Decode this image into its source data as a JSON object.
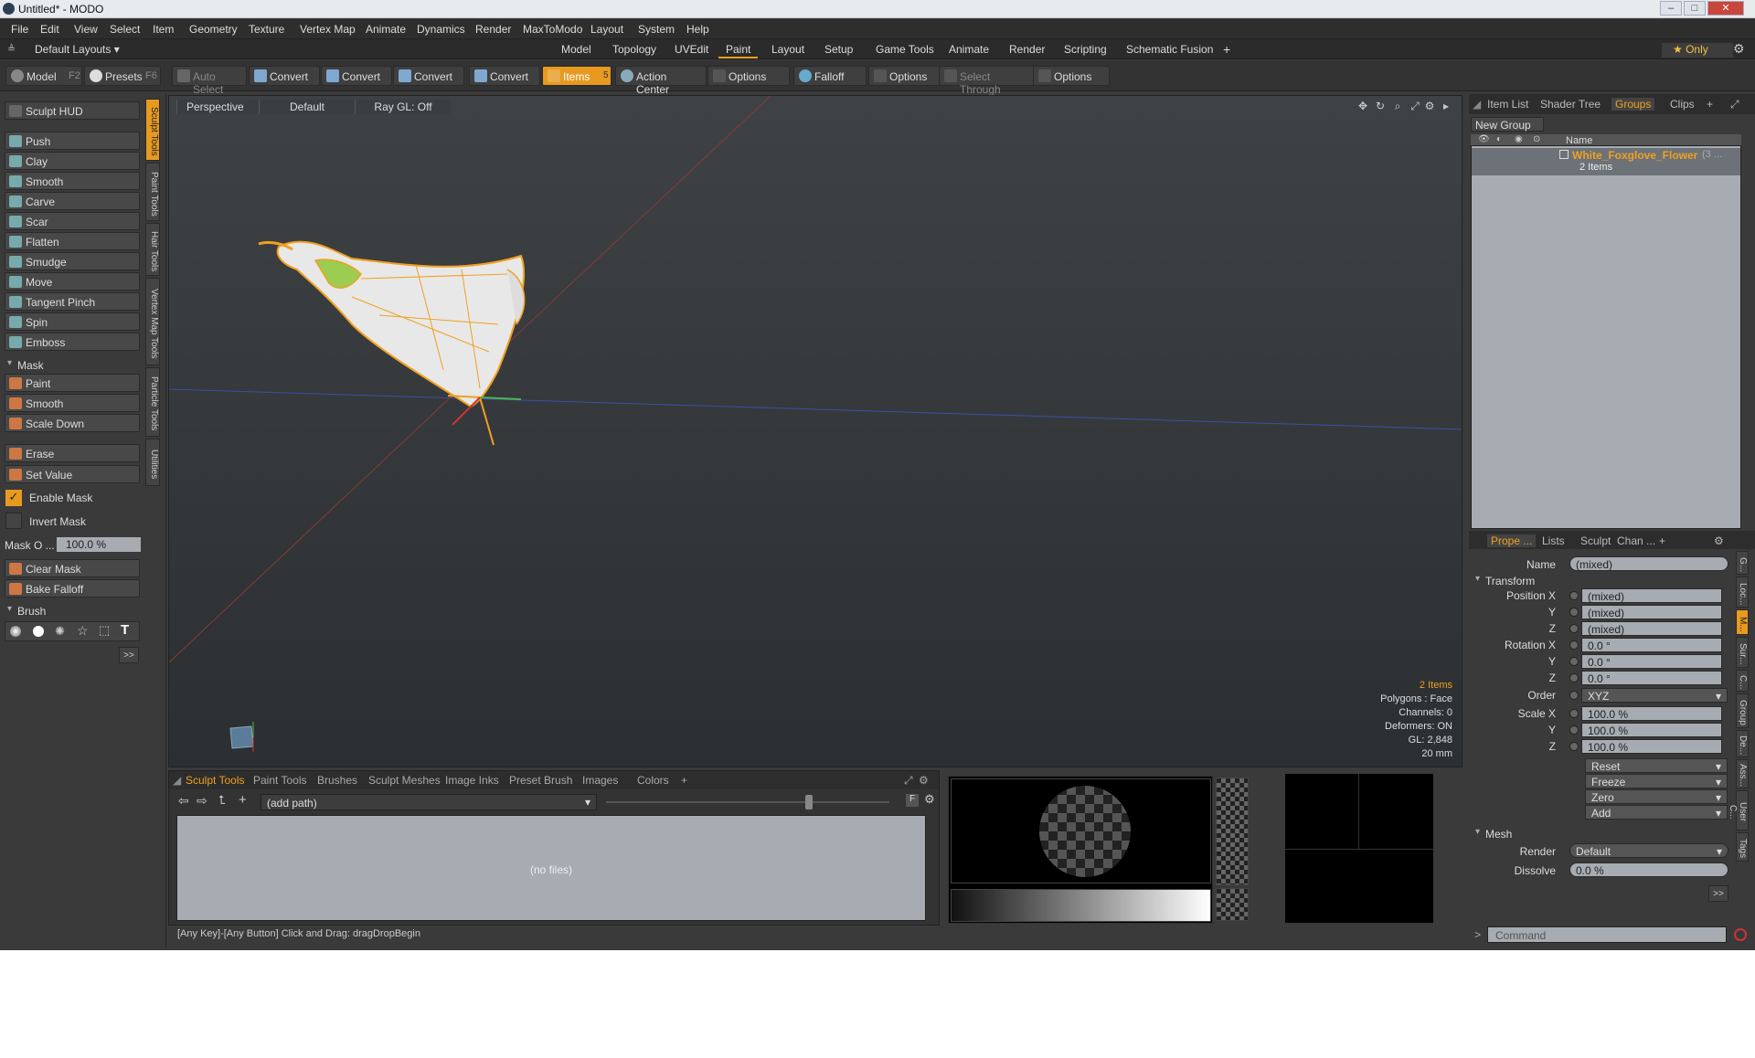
{
  "window": {
    "title": "Untitled* - MODO"
  },
  "menu": [
    "File",
    "Edit",
    "View",
    "Select",
    "Item",
    "Geometry",
    "Texture",
    "Vertex Map",
    "Animate",
    "Dynamics",
    "Render",
    "MaxToModo",
    "Layout",
    "System",
    "Help"
  ],
  "layoutbar": {
    "layout_name": "Default Layouts ▾",
    "tabs": [
      "Model",
      "Topology",
      "UVEdit",
      "Paint",
      "Layout",
      "Setup",
      "Game Tools",
      "Animate",
      "Render",
      "Scripting",
      "Schematic Fusion"
    ],
    "active": "Paint",
    "add": "+",
    "only": "★ Only"
  },
  "toolbar": {
    "model": "Model",
    "model_key": "F2",
    "presets": "Presets",
    "presets_key": "F6",
    "auto_select": "Auto Select",
    "convert": "Convert",
    "items": "Items",
    "items_key": "5",
    "action_center": "Action Center",
    "options": "Options",
    "falloff": "Falloff",
    "select_through": "Select Through"
  },
  "sculpt": {
    "hud": "Sculpt HUD",
    "tools": [
      "Push",
      "Clay",
      "Smooth",
      "Carve",
      "Scar",
      "Flatten",
      "Smudge",
      "Move",
      "Tangent Pinch",
      "Spin",
      "Emboss"
    ],
    "mask_header": "Mask",
    "mask_tools": [
      "Paint",
      "Smooth",
      "Scale Down"
    ],
    "erase": "Erase",
    "set_value": "Set Value",
    "enable_mask": "Enable Mask",
    "invert_mask": "Invert Mask",
    "mask_opacity_label": "Mask O ...",
    "mask_opacity_value": "100.0 %",
    "clear_mask": "Clear Mask",
    "bake_falloff": "Bake Falloff",
    "brush_header": "Brush",
    "more": ">>"
  },
  "vtabs": [
    "Sculpt Tools",
    "Paint Tools",
    "Hair Tools",
    "Vertex Map Tools",
    "Particle Tools",
    "Utilities"
  ],
  "viewport": {
    "projection": "Perspective",
    "shading": "Default",
    "raygl": "Ray GL: Off",
    "stats": {
      "items": "2 Items",
      "polygons": "Polygons : Face",
      "channels": "Channels: 0",
      "deformers": "Deformers: ON",
      "gl": "GL: 2,848",
      "scale": "20 mm"
    }
  },
  "bottom": {
    "tabs": [
      "Sculpt Tools",
      "Paint Tools",
      "Brushes",
      "Sculpt Meshes",
      "Image Inks",
      "Preset Brush",
      "Images",
      "Colors"
    ],
    "add": "+",
    "path": "(add path)",
    "empty": "(no files)",
    "f": "F"
  },
  "status": "[Any Key]-[Any Button] Click and Drag:  dragDropBegin",
  "right": {
    "tabs": [
      "Item List",
      "Shader Tree",
      "Groups",
      "Clips"
    ],
    "active": "Groups",
    "new_group": "New Group",
    "col_name": "Name",
    "group_name": "White_Foxglove_Flower",
    "group_count": "(3 ...",
    "group_items": "2 Items"
  },
  "props": {
    "tabs": [
      "Prope ...",
      "Lists",
      "Sculpt",
      "Chan ..."
    ],
    "name_label": "Name",
    "name_value": "(mixed)",
    "transform": "Transform",
    "position_x": "Position X",
    "y": "Y",
    "z": "Z",
    "mixed": "(mixed)",
    "rotation_x": "Rotation X",
    "deg": "0.0 °",
    "order_label": "Order",
    "order": "XYZ",
    "scale_x": "Scale X",
    "pct": "100.0 %",
    "reset": "Reset",
    "freeze": "Freeze",
    "zero": "Zero",
    "add": "Add",
    "mesh": "Mesh",
    "render_label": "Render",
    "render_value": "Default",
    "dissolve_label": "Dissolve",
    "dissolve_value": "0.0 %",
    "more": ">>",
    "command": "Command",
    "side_tabs": [
      "G...",
      "Loc...",
      "M...",
      "Sur...",
      "C...",
      "Group",
      "De...",
      "Ass...",
      "User C...",
      "Tags"
    ]
  },
  "colors": {
    "accent": "#f0a020",
    "panel": "#3a3a3a",
    "field": "#a6acb2"
  }
}
